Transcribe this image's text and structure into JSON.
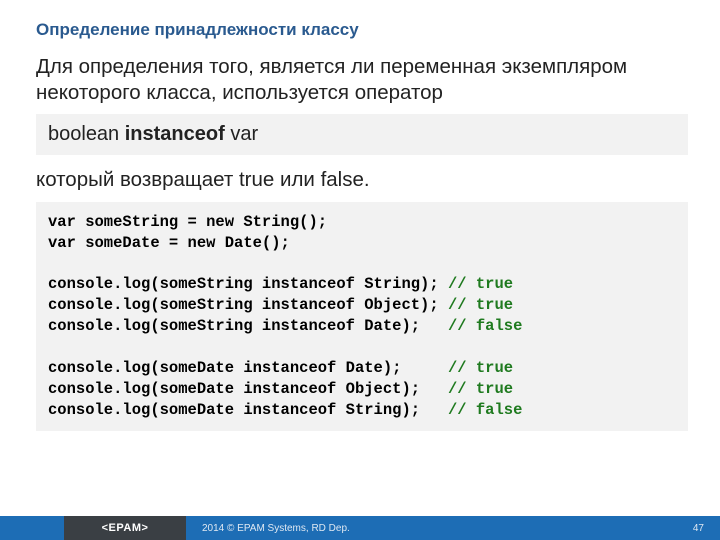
{
  "title": "Определение принадлежности классу",
  "para1": "Для определения того, является ли переменная экземпляром некоторого класса, используется оператор",
  "syntax": {
    "pre": "boolean ",
    "kw": "instanceof",
    "post": " var"
  },
  "para2": "который возвращает true или false.",
  "code": {
    "l1": "var someString = new String();",
    "l2": "var someDate = new Date();",
    "l3": "console.log(someString instanceof String); ",
    "c3": "// true",
    "l4": "console.log(someString instanceof Object); ",
    "c4": "// true",
    "l5": "console.log(someString instanceof Date);   ",
    "c5": "// false",
    "l6": "console.log(someDate instanceof Date);     ",
    "c6": "// true",
    "l7": "console.log(someDate instanceof Object);   ",
    "c7": "// true",
    "l8": "console.log(someDate instanceof String);   ",
    "c8": "// false"
  },
  "footer": {
    "logo": "<EPAM>",
    "copyright": "2014 © EPAM Systems, RD Dep.",
    "page": "47"
  }
}
